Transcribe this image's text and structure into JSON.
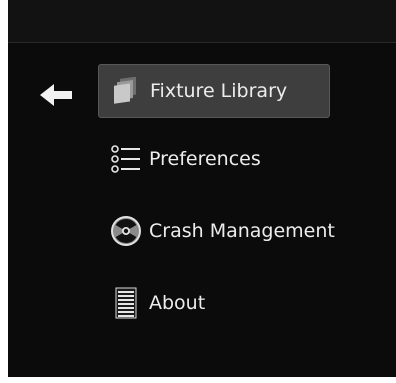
{
  "colors": {
    "background": "#0b0b0b",
    "topbar": "#121212",
    "active_item": "#3e3e3e",
    "text": "#ececec"
  },
  "navigation": {
    "back_icon": "arrow-left-icon"
  },
  "menu": {
    "items": [
      {
        "label": "Fixture Library",
        "icon": "folders-icon",
        "active": true
      },
      {
        "label": "Preferences",
        "icon": "list-icon",
        "active": false
      },
      {
        "label": "Crash Management",
        "icon": "radiation-icon",
        "active": false
      },
      {
        "label": "About",
        "icon": "document-icon",
        "active": false
      }
    ]
  }
}
